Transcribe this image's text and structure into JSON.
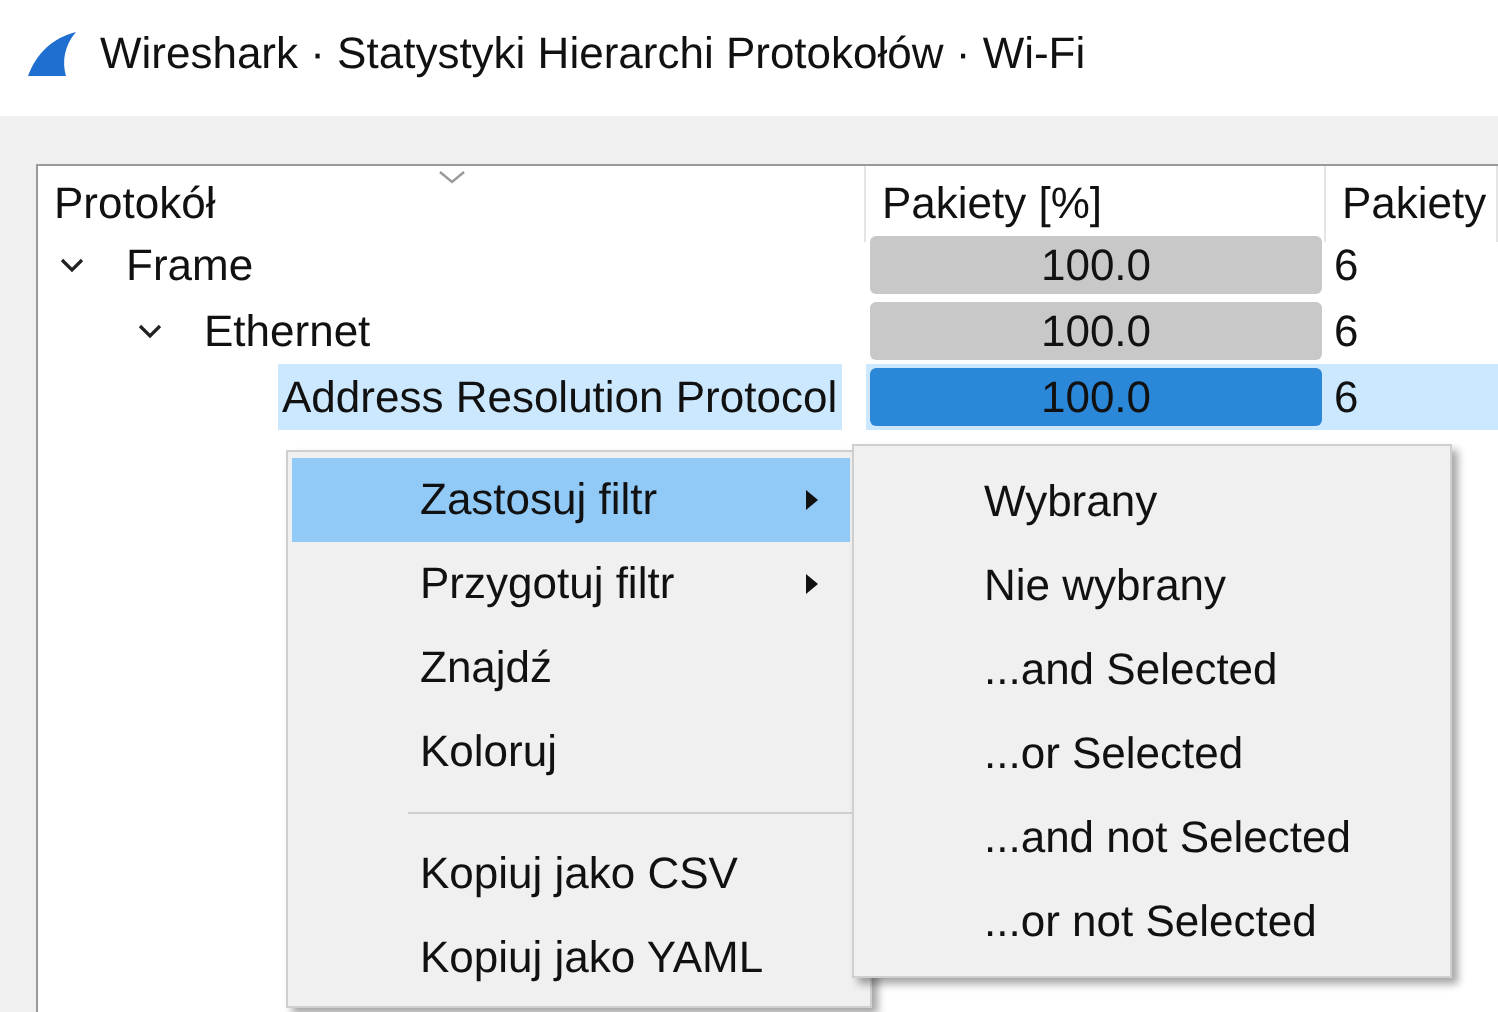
{
  "window": {
    "title": "Wireshark · Statystyki Hierarchi Protokołów · Wi-Fi"
  },
  "table": {
    "columns": [
      "Protokół",
      "Pakiety [%]",
      "Pakiety"
    ],
    "rows": [
      {
        "protocol": "Frame",
        "percent": "100.0",
        "level": 1.0,
        "packets": "6",
        "expanded": true,
        "selected": false,
        "children": [
          {
            "protocol": "Ethernet",
            "percent": "100.0",
            "level": 1.0,
            "packets": "6",
            "expanded": true,
            "selected": false,
            "children": [
              {
                "protocol": "Address Resolution Protocol",
                "percent": "100.0",
                "level": 1.0,
                "packets": "6",
                "selected": true
              }
            ]
          }
        ]
      }
    ]
  },
  "context_menu": {
    "items": [
      {
        "kind": "item",
        "label": "Zastosuj filtr",
        "submenu": true,
        "selected": true
      },
      {
        "kind": "item",
        "label": "Przygotuj filtr",
        "submenu": true,
        "selected": false
      },
      {
        "kind": "item",
        "label": "Znajdź",
        "submenu": false,
        "selected": false
      },
      {
        "kind": "item",
        "label": "Koloruj",
        "submenu": false,
        "selected": false
      },
      {
        "kind": "separator"
      },
      {
        "kind": "item",
        "label": "Kopiuj jako CSV",
        "submenu": false,
        "selected": false
      },
      {
        "kind": "item",
        "label": "Kopiuj jako YAML",
        "submenu": false,
        "selected": false
      }
    ]
  },
  "submenu": {
    "items": [
      "Wybrany",
      "Nie wybrany",
      "...and Selected",
      "...or Selected",
      "...and not Selected",
      "...or not Selected"
    ]
  }
}
